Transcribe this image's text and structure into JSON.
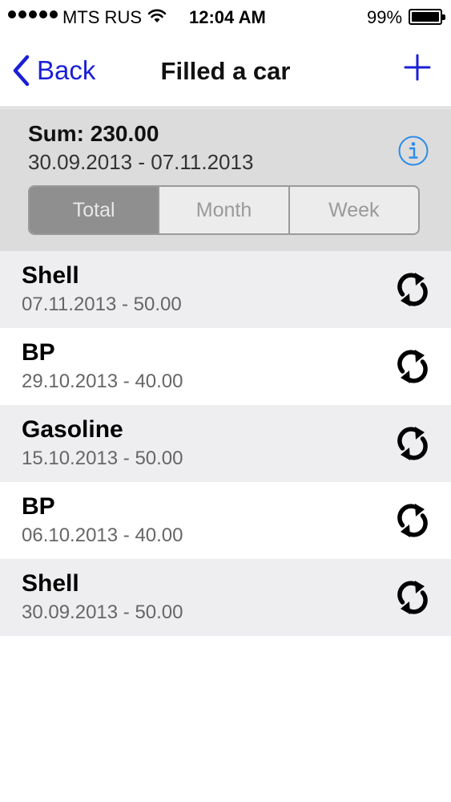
{
  "status_bar": {
    "carrier": "MTS RUS",
    "time": "12:04 AM",
    "battery": "99%",
    "battery_level": 0.99,
    "signal_dots": 5
  },
  "nav": {
    "back_label": "Back",
    "title": "Filled a car",
    "add_icon": "plus-icon"
  },
  "summary": {
    "sum": "Sum: 230.00",
    "date_range": "30.09.2013 - 07.11.2013",
    "info_icon": "info-icon"
  },
  "segments": {
    "selected": "Total",
    "items": [
      {
        "label": "Total"
      },
      {
        "label": "Month"
      },
      {
        "label": "Week"
      }
    ]
  },
  "list": {
    "items": [
      {
        "title": "Shell",
        "subtitle": "07.11.2013 - 50.00"
      },
      {
        "title": "BP",
        "subtitle": "29.10.2013 - 40.00"
      },
      {
        "title": "Gasoline",
        "subtitle": "15.10.2013 - 50.00"
      },
      {
        "title": "BP",
        "subtitle": "06.10.2013 - 40.00"
      },
      {
        "title": "Shell",
        "subtitle": "30.09.2013 - 50.00"
      }
    ],
    "row_icon": "refresh-icon"
  },
  "colors": {
    "accent": "#1a1fd6",
    "info_blue": "#2a8ce8",
    "summary_bg": "#dcdcdc",
    "segment_active": "#8f8f8f"
  }
}
